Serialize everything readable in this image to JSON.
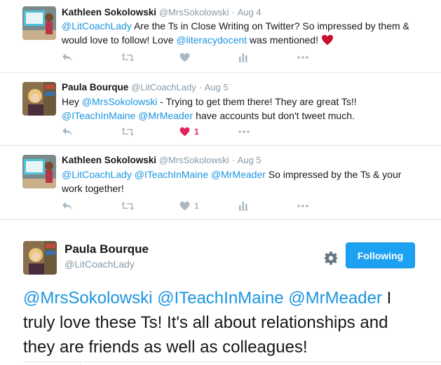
{
  "tweets": [
    {
      "name": "Kathleen Sokolowski",
      "handle": "@MrsSokolowski",
      "dot": "·",
      "time": "Aug 4",
      "line1": [
        {
          "t": "@LitCoachLady",
          "m": true
        },
        {
          "t": " Are the Ts in Close Writing on Twitter? So impressed by them &",
          "m": false
        }
      ],
      "line2": [
        {
          "t": "would love to follow! Love ",
          "m": false
        },
        {
          "t": "@literacydocent",
          "m": true
        },
        {
          "t": " was mentioned! ",
          "m": false
        }
      ],
      "like_count": "",
      "liked": false
    },
    {
      "name": "Paula Bourque",
      "handle": "@LitCoachLady",
      "dot": "·",
      "time": "Aug 5",
      "line1": [
        {
          "t": "Hey ",
          "m": false
        },
        {
          "t": "@MrsSokolowski",
          "m": true
        },
        {
          "t": " - Trying to get them there! They are great Ts!!",
          "m": false
        }
      ],
      "line2": [
        {
          "t": "@ITeachInMaine",
          "m": true
        },
        {
          "t": " ",
          "m": false
        },
        {
          "t": "@MrMeader",
          "m": true
        },
        {
          "t": " have accounts but don't tweet much.",
          "m": false
        }
      ],
      "like_count": "1",
      "liked": true
    },
    {
      "name": "Kathleen Sokolowski",
      "handle": "@MrsSokolowski",
      "dot": "·",
      "time": "Aug 5",
      "line1": [
        {
          "t": "@LitCoachLady",
          "m": true
        },
        {
          "t": " ",
          "m": false
        },
        {
          "t": "@ITeachInMaine",
          "m": true
        },
        {
          "t": " ",
          "m": false
        },
        {
          "t": "@MrMeader",
          "m": true
        },
        {
          "t": " So impressed by the Ts & your",
          "m": false
        }
      ],
      "line2": [
        {
          "t": "work together!",
          "m": false
        }
      ],
      "like_count": "1",
      "liked": false
    }
  ],
  "main_tweet": {
    "name": "Paula Bourque",
    "handle": "@LitCoachLady",
    "follow_label": "Following",
    "lines": [
      [
        {
          "t": "@MrsSokolowski",
          "m": true
        },
        {
          "t": " ",
          "m": false
        },
        {
          "t": "@ITeachInMaine",
          "m": true
        },
        {
          "t": " ",
          "m": false
        },
        {
          "t": "@MrMeader",
          "m": true
        },
        {
          "t": " I",
          "m": false
        }
      ],
      [
        {
          "t": "truly love these Ts! It's all about relationships and",
          "m": false
        }
      ],
      [
        {
          "t": "they are friends as well as colleagues!",
          "m": false
        }
      ]
    ]
  },
  "colors": {
    "accent": "#1da1f2",
    "mention": "#1b95e0",
    "like": "#e0245e",
    "icon_gray": "#aab8c2"
  },
  "icons": [
    "reply-icon",
    "retweet-icon",
    "like-icon",
    "analytics-icon",
    "more-icon",
    "gear-icon"
  ]
}
